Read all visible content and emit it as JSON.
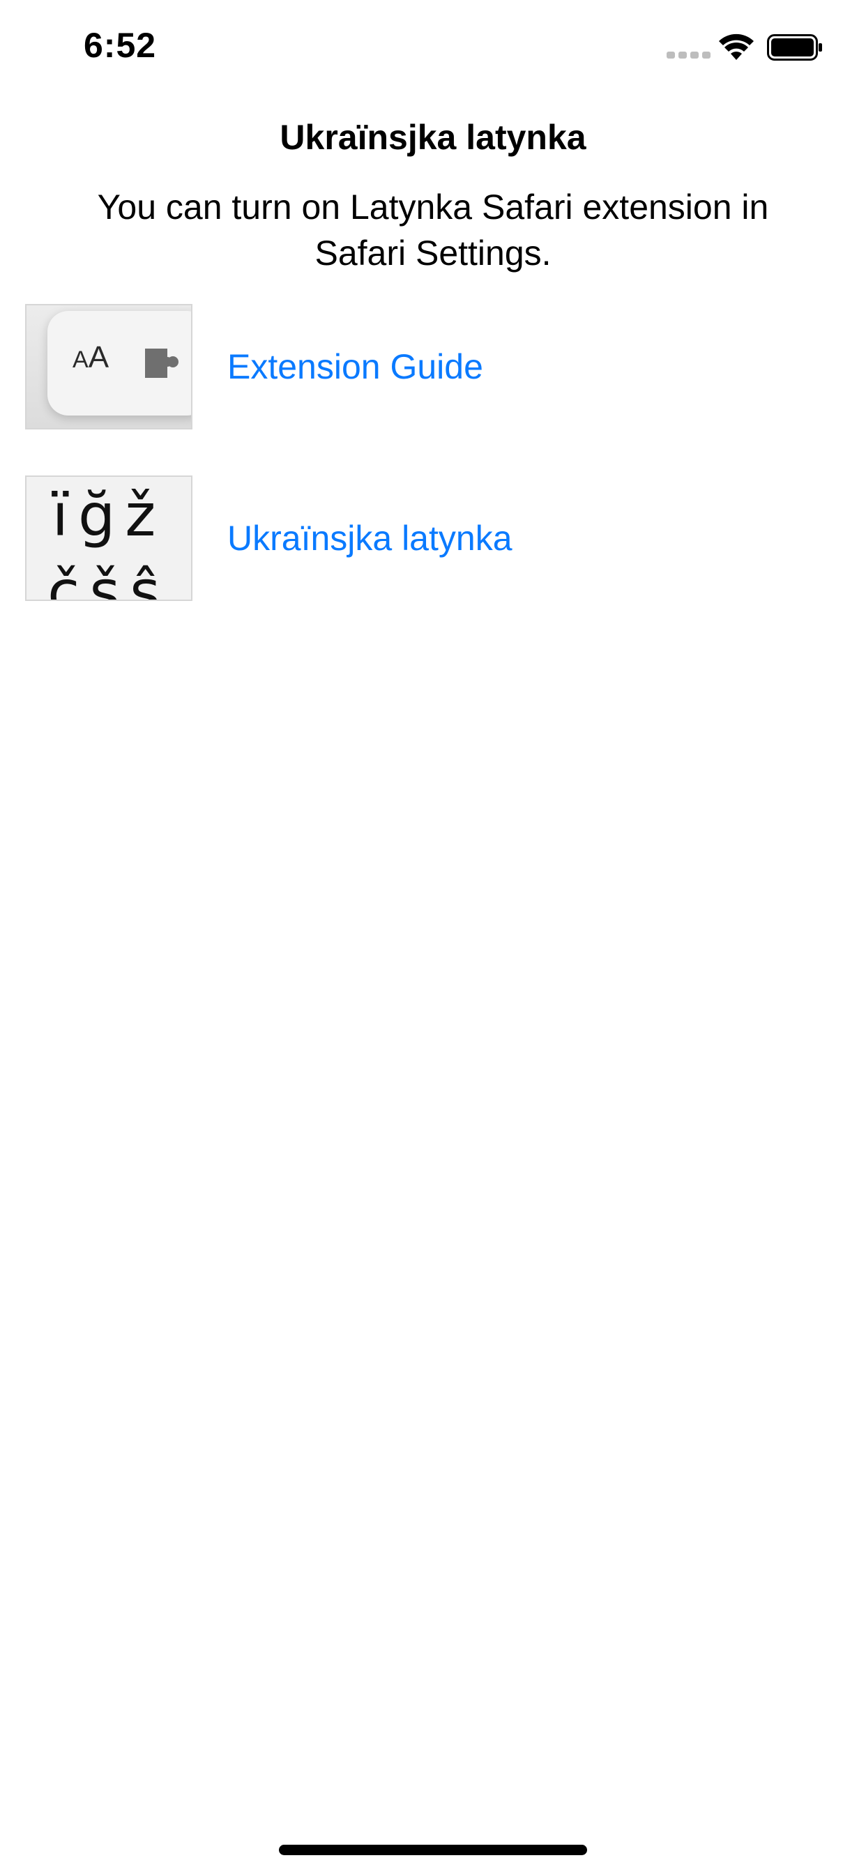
{
  "status_bar": {
    "time": "6:52"
  },
  "page": {
    "title": "Ukraïnsjka latynka",
    "subtitle": "You can turn on Latynka Safari extension in Safari Settings."
  },
  "rows": [
    {
      "label": "Extension Guide",
      "thumbnail_text": "AA",
      "thumbnail_icon": "puzzle-piece-icon"
    },
    {
      "label": "Ukraïnsjka latynka",
      "thumbnail_line1": "ïğž",
      "thumbnail_line2": "čšŝ"
    }
  ],
  "colors": {
    "link": "#0a7aff",
    "background": "#ffffff"
  }
}
